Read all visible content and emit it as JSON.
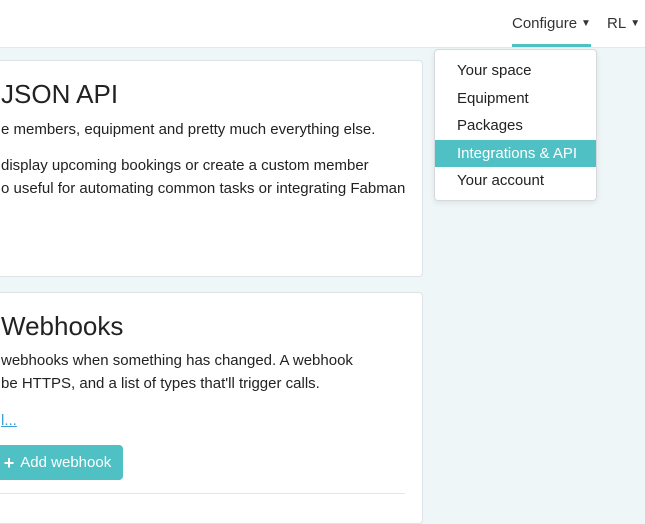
{
  "nav": {
    "configure_label": "Configure",
    "user_label": "RL"
  },
  "json_api": {
    "title": "JSON API",
    "line1": "e members, equipment and pretty much everything else.",
    "line2": "display upcoming bookings or create a custom member",
    "line3": "o useful for automating common tasks or integrating Fabman"
  },
  "webhooks": {
    "title": "Webhooks",
    "line1": "webhooks when something has changed. A webhook",
    "line2": "be HTTPS, and a list of types that'll trigger calls.",
    "link_text": "l...",
    "add_button_label": "Add webhook"
  },
  "dropdown": {
    "items": [
      {
        "label": "Your space"
      },
      {
        "label": "Equipment"
      },
      {
        "label": "Packages"
      },
      {
        "label": "Integrations & API"
      },
      {
        "label": "Your account"
      }
    ],
    "active_index": 3
  },
  "colors": {
    "accent": "#4fc1c4",
    "link": "#3a9fd8"
  }
}
